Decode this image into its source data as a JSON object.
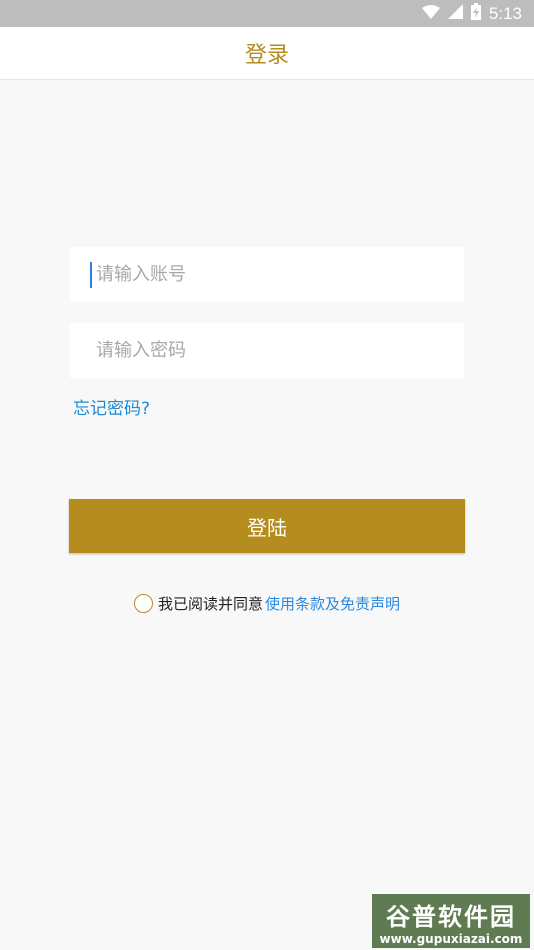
{
  "status_bar": {
    "time": "5:13",
    "icons": [
      "wifi-icon",
      "cell-signal-icon",
      "battery-charging-icon"
    ]
  },
  "header": {
    "title": "登录"
  },
  "form": {
    "account_placeholder": "请输入账号",
    "password_placeholder": "请输入密码",
    "forgot_label": "忘记密码?",
    "login_label": "登陆"
  },
  "agreement": {
    "text": "我已阅读并同意",
    "link_text": "使用条款及免责声明"
  },
  "watermark": {
    "main": "谷普软件园",
    "sub": "www.gupuxiazai.com"
  },
  "colors": {
    "brand_gold": "#b58d1f",
    "link_blue": "#2a8ae0",
    "background": "#f8f8f8"
  }
}
